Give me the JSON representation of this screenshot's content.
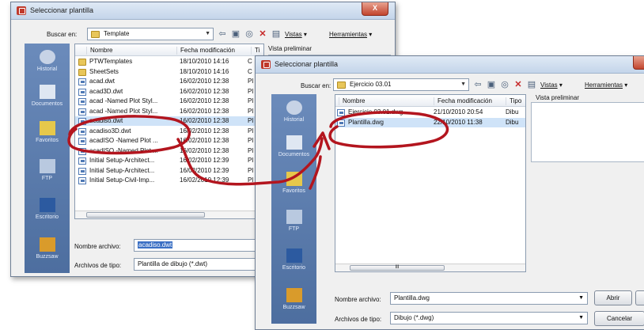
{
  "accent_color": "#b3151e",
  "dialog1": {
    "title": "Seleccionar plantilla",
    "close_label": "X",
    "lookin_label": "Buscar en:",
    "lookin_value": "Template",
    "menu_vistas": "Vistas",
    "menu_herramientas": "Herramientas",
    "preview_label": "Vista preliminar",
    "places": [
      "Historial",
      "Documentos",
      "Favoritos",
      "FTP",
      "Escritorio",
      "Buzzsaw"
    ],
    "columns": [
      "Nombre",
      "Fecha modificación",
      "Ti"
    ],
    "files": [
      {
        "name": "PTWTemplates",
        "date": "18/10/2010 14:16",
        "type": "C",
        "icon": "folder"
      },
      {
        "name": "SheetSets",
        "date": "18/10/2010 14:16",
        "type": "C",
        "icon": "folder"
      },
      {
        "name": "acad.dwt",
        "date": "16/02/2010 12:38",
        "type": "Pl",
        "icon": "dwt"
      },
      {
        "name": "acad3D.dwt",
        "date": "16/02/2010 12:38",
        "type": "Pl",
        "icon": "dwt"
      },
      {
        "name": "acad -Named Plot Styl...",
        "date": "16/02/2010 12:38",
        "type": "Pl",
        "icon": "dwt"
      },
      {
        "name": "acad -Named Plot Styl...",
        "date": "16/02/2010 12:38",
        "type": "Pl",
        "icon": "dwt"
      },
      {
        "name": "acadiso.dwt",
        "date": "16/02/2010 12:38",
        "type": "Pl",
        "icon": "dwt",
        "selected": true
      },
      {
        "name": "acadiso3D.dwt",
        "date": "16/02/2010 12:38",
        "type": "Pl",
        "icon": "dwt"
      },
      {
        "name": "acadISO -Named Plot ...",
        "date": "16/02/2010 12:38",
        "type": "Pl",
        "icon": "dwt"
      },
      {
        "name": "acadISO -Named Plot ...",
        "date": "16/02/2010 12:38",
        "type": "Pl",
        "icon": "dwt"
      },
      {
        "name": "Initial Setup-Architect...",
        "date": "16/02/2010 12:39",
        "type": "Pl",
        "icon": "dwt"
      },
      {
        "name": "Initial Setup-Architect...",
        "date": "16/02/2010 12:39",
        "type": "Pl",
        "icon": "dwt"
      },
      {
        "name": "Initial Setup-Civil-Imp...",
        "date": "16/02/2010 12:39",
        "type": "Pl",
        "icon": "dwt"
      }
    ],
    "filename_label": "Nombre archivo:",
    "filename_value": "acadiso.dwt",
    "filetype_label": "Archivos de tipo:",
    "filetype_value": "Plantilla de dibujo (*.dwt)"
  },
  "dialog2": {
    "title": "Seleccionar plantilla",
    "lookin_label": "Buscar en:",
    "lookin_value": "Ejercicio 03.01",
    "menu_vistas": "Vistas",
    "menu_herramientas": "Herramientas",
    "preview_label": "Vista preliminar",
    "places": [
      "Historial",
      "Documentos",
      "Favoritos",
      "FTP",
      "Escritorio",
      "Buzzsaw"
    ],
    "columns": [
      "Nombre",
      "Fecha modificación",
      "Tipo"
    ],
    "files": [
      {
        "name": "Ejercicio 03.01.dwg",
        "date": "21/10/2010 20:54",
        "type": "Dibu",
        "icon": "dwt"
      },
      {
        "name": "Plantilla.dwg",
        "date": "22/10/2010 11:38",
        "type": "Dibu",
        "icon": "dwt",
        "selected": true
      }
    ],
    "scroll_marker": "III",
    "filename_label": "Nombre archivo:",
    "filename_value": "Plantilla.dwg",
    "filetype_label": "Archivos de tipo:",
    "filetype_value": "Dibujo (*.dwg)",
    "open_button": "Abrir",
    "cancel_button": "Cancelar"
  }
}
